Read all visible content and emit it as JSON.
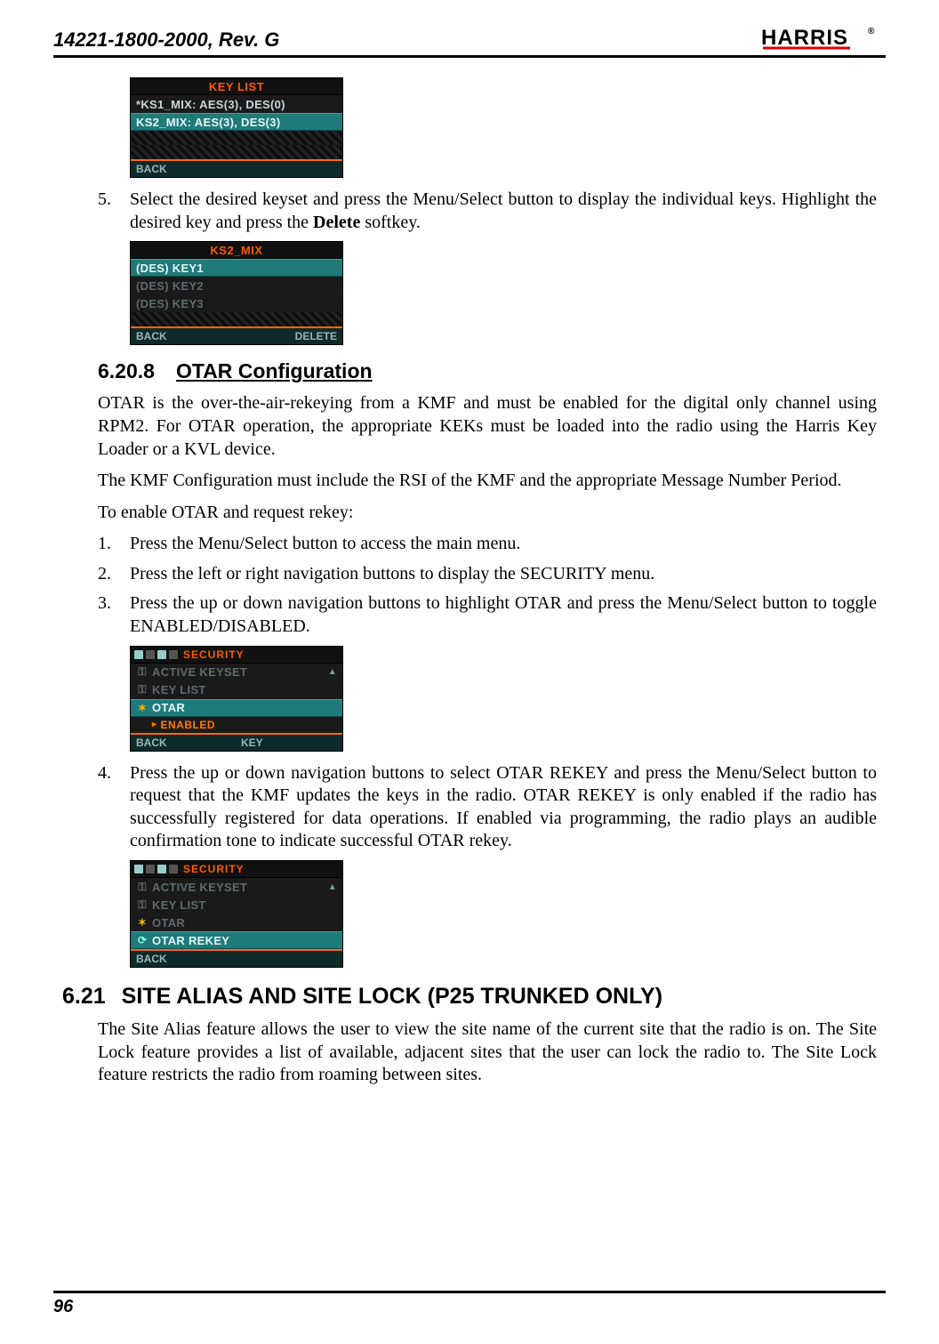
{
  "doc_id": "14221-1800-2000, Rev. G",
  "logo_text": "HARRIS",
  "page_number": "96",
  "screen1": {
    "title": "KEY LIST",
    "row1": "*KS1_MIX: AES(3), DES(0)",
    "row2": "KS2_MIX: AES(3), DES(3)",
    "back": "BACK"
  },
  "step5_prefix": "Select the desired keyset and press the Menu/Select button to display the individual keys. Highlight the desired key and press the ",
  "step5_bold": "Delete",
  "step5_suffix": " softkey.",
  "screen2": {
    "title": "KS2_MIX",
    "row1": "(DES) KEY1",
    "row2": "(DES) KEY2",
    "row3": "(DES) KEY3",
    "back": "BACK",
    "delete": "DELETE"
  },
  "h3_num": "6.20.8",
  "h3_title": "OTAR Configuration",
  "p1": "OTAR is the over-the-air-rekeying from a KMF and must be enabled for the digital only channel using RPM2. For OTAR operation, the appropriate KEKs must be loaded into the radio using the Harris Key Loader or a KVL device.",
  "p2": "The KMF Configuration must include the RSI of the KMF and the appropriate Message Number Period.",
  "p3": "To enable OTAR and request rekey:",
  "otar_step1": "Press the Menu/Select button to access the main menu.",
  "otar_step2": "Press the left or right navigation buttons to display the SECURITY menu.",
  "otar_step3": "Press the up or down navigation buttons to highlight OTAR and press the Menu/Select button to toggle ENABLED/DISABLED.",
  "screen3": {
    "title": "SECURITY",
    "row1": "ACTIVE KEYSET",
    "row2": "KEY LIST",
    "row3": "OTAR",
    "sub": "ENABLED",
    "back": "BACK",
    "mid": "KEY"
  },
  "otar_step4": "Press the up or down navigation buttons to select OTAR REKEY and press the Menu/Select button to request that the KMF updates the keys in the radio.  OTAR REKEY is only enabled if the radio has successfully registered for data operations.  If enabled via programming, the radio plays an audible confirmation tone to indicate successful OTAR rekey.",
  "screen4": {
    "title": "SECURITY",
    "row1": "ACTIVE KEYSET",
    "row2": "KEY LIST",
    "row3": "OTAR",
    "row4": "OTAR REKEY",
    "back": "BACK"
  },
  "h2_num": "6.21",
  "h2_title": "SITE ALIAS AND SITE LOCK (P25 TRUNKED ONLY)",
  "p_sitealias": "The Site Alias feature allows the user to view the site name of the current site that the radio is on. The Site Lock feature provides a list of available, adjacent sites that the user can lock the radio to. The Site Lock feature restricts the radio from roaming between sites."
}
